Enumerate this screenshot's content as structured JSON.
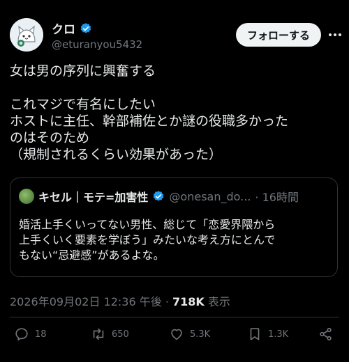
{
  "author": {
    "name": "クロ",
    "handle": "@eturanyou5432",
    "verified": true,
    "avatar_icon": "cat-avatar"
  },
  "header": {
    "follow_label": "フォローする",
    "more_icon": "more-dots-icon"
  },
  "tweet": {
    "text": "女は男の序列に興奮する\n\nこれマジで有名にしたい\nホストに主任、幹部補佐とか謎の役職多かった\nのはそのため\n（規制されるくらい効果があった）"
  },
  "quote": {
    "name": "キセル｜モテ=加害性",
    "handle": "@onesan_do...",
    "time": "· 16時間",
    "verified": true,
    "text": "婚活上手くいってない男性、総じて「恋愛界隈から\n上手くいく要素を学ぼう」みたいな考え方にとんで\nもない“忌避感”があるよな。"
  },
  "meta": {
    "timestamp": "2026年09月02日 12:36 午後",
    "separator": " · ",
    "views": "718K",
    "views_label": " 表示"
  },
  "actions": {
    "replies": "18",
    "reposts": "650",
    "likes": "5.3K",
    "bookmarks": "1.3K"
  },
  "colors": {
    "background": "#000000",
    "text": "#e7e9ea",
    "muted": "#71767b",
    "verified": "#1d9bf0",
    "border": "#2f3336"
  }
}
